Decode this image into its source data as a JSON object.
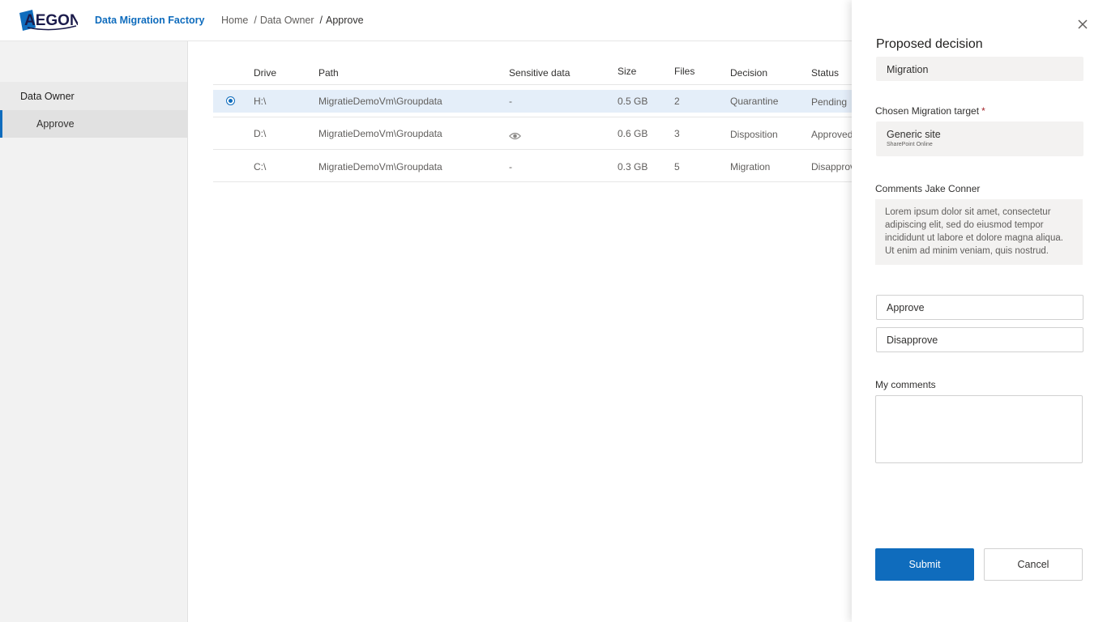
{
  "header": {
    "logo_text": "AEGON",
    "app_title": "Data Migration Factory",
    "breadcrumb": [
      "Home",
      "Data Owner",
      "Approve"
    ]
  },
  "sidebar": {
    "group": "Data Owner",
    "items": [
      {
        "label": "Approve",
        "active": true
      }
    ]
  },
  "table": {
    "columns": [
      "Drive",
      "Path",
      "Sensitive data",
      "Size",
      "Files",
      "Decision",
      "Status"
    ],
    "rows": [
      {
        "drive": "H:\\",
        "path": "MigratieDemoVm\\Groupdata",
        "sensitive": "-",
        "size": "0.5 GB",
        "files": "2",
        "decision": "Quarantine",
        "status": "Pending",
        "selected": true
      },
      {
        "drive": "D:\\",
        "path": "MigratieDemoVm\\Groupdata",
        "sensitive": "eye-icon",
        "size": "0.6 GB",
        "files": "3",
        "decision": "Disposition",
        "status": "Approved"
      },
      {
        "drive": "C:\\",
        "path": "MigratieDemoVm\\Groupdata",
        "sensitive": "-",
        "size": "0.3 GB",
        "files": "5",
        "decision": "Migration",
        "status": "Disapprov"
      }
    ]
  },
  "panel": {
    "title": "Proposed decision",
    "proposed_value": "Migration",
    "target_label": "Chosen Migration target",
    "required_mark": "*",
    "target_value": "Generic site",
    "target_sub": "SharePoint Online",
    "comments_label": "Comments Jake Conner",
    "comments_text": "Lorem ipsum dolor sit amet, consectetur adipiscing elit, sed do eiusmod tempor incididunt ut labore et dolore magna aliqua. Ut enim ad minim veniam, quis nostrud.",
    "approve_label": "Approve",
    "disapprove_label": "Disapprove",
    "my_comments_label": "My comments",
    "submit_label": "Submit",
    "cancel_label": "Cancel"
  },
  "colors": {
    "accent": "#0f6cbd",
    "selected_row": "#e4eef9",
    "required": "#a4262c"
  }
}
